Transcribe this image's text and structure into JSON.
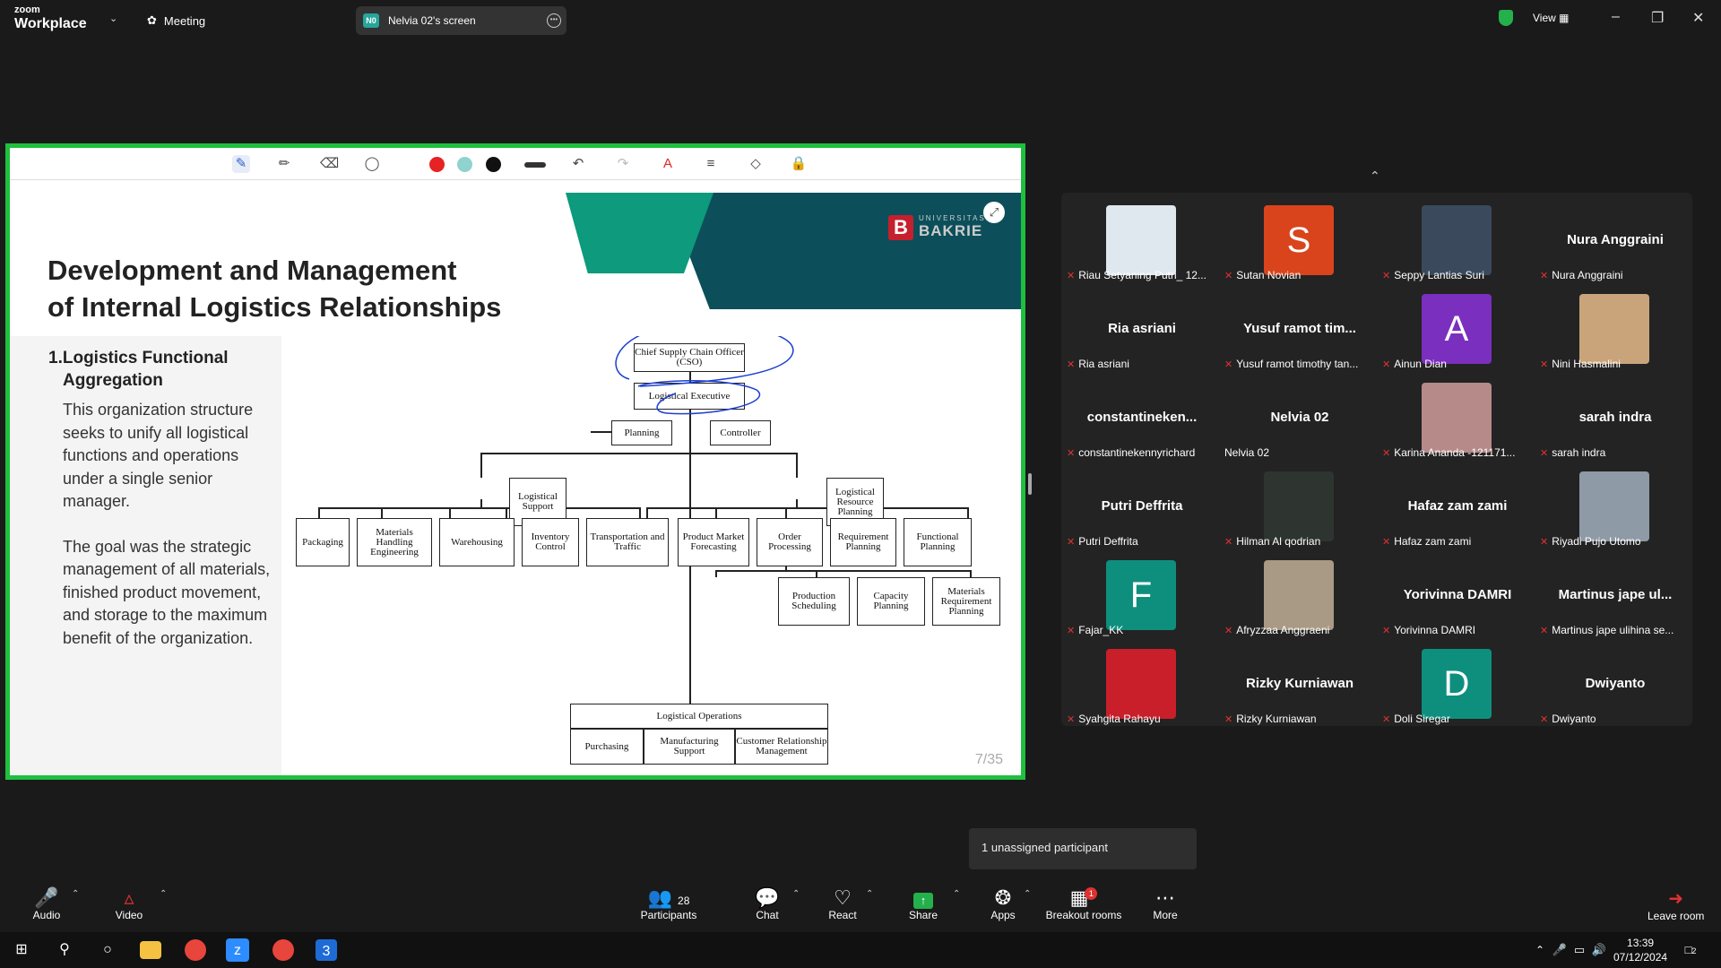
{
  "app": {
    "logo_top": "zoom",
    "logo_bottom": "Workplace",
    "meeting_label": "Meeting",
    "screen_badge": "N0",
    "screen_label": "Nelvia 02's screen",
    "view_label": "View"
  },
  "slide": {
    "title_line1": "Development and Management",
    "title_line2": "of Internal Logistics Relationships",
    "section_number": "1.",
    "section_title_line1": "Logistics Functional",
    "section_title_line2": "Aggregation",
    "paragraph1": "This organization structure seeks to unify all logistical functions and operations under a single senior manager.",
    "paragraph2": "The goal was the strategic management of all materials, finished product movement, and storage to the maximum benefit of the organization.",
    "brand_small": "UNIVERSITAS",
    "brand_big": "BAKRIE",
    "page": "7/35",
    "org": {
      "cso": "Chief Supply Chain Officer (CSO)",
      "exec": "Logistical Executive",
      "planning": "Planning",
      "controller": "Controller",
      "support": "Logistical Support",
      "resource": "Logistical Resource Planning",
      "packaging": "Packaging",
      "materials_handling": "Materials Handling Engineering",
      "warehousing": "Warehousing",
      "inventory": "Inventory Control",
      "transport": "Transportation and Traffic",
      "forecasting": "Product Market Forecasting",
      "order": "Order Processing",
      "requirement": "Requirement Planning",
      "functional": "Functional Planning",
      "production": "Production Scheduling",
      "capacity": "Capacity Planning",
      "mrp": "Materials Requirement Planning",
      "operations": "Logistical Operations",
      "purchasing": "Purchasing",
      "manufacturing": "Manufacturing Support",
      "crm": "Customer Relationship Management"
    }
  },
  "participants": [
    {
      "label": "Riau Setyaning Putri_ 12...",
      "avatar": "photo",
      "color": "#dfe7ef",
      "muted": true
    },
    {
      "label": "Sutan Novian",
      "avatar": "S",
      "color": "#d9441c",
      "muted": true
    },
    {
      "label": "Seppy Lantias Suri",
      "avatar": "photo",
      "color": "#3a4a5c",
      "muted": true
    },
    {
      "label": "Nura Anggraini",
      "big": "Nura Anggraini",
      "muted": true
    },
    {
      "label": "Ria asriani",
      "big": "Ria asriani",
      "muted": true
    },
    {
      "label": "Yusuf ramot timothy tan...",
      "big": "Yusuf ramot tim...",
      "muted": true
    },
    {
      "label": "Ainun Dian",
      "avatar": "A",
      "color": "#7b2fbe",
      "muted": true
    },
    {
      "label": "Nini Hasmalini",
      "avatar": "photo",
      "color": "#c9a47a",
      "muted": true
    },
    {
      "label": "constantinekennyrichard",
      "big": "constantineken...",
      "muted": true
    },
    {
      "label": "Nelvia 02",
      "big": "Nelvia 02",
      "muted": false
    },
    {
      "label": "Karina Ananda -121171...",
      "avatar": "photo",
      "color": "#b78a8a",
      "muted": true
    },
    {
      "label": "sarah indra",
      "big": "sarah indra",
      "muted": true
    },
    {
      "label": "Putri Deffrita",
      "big": "Putri Deffrita",
      "muted": true
    },
    {
      "label": "Hilman Al qodrian",
      "avatar": "photo",
      "color": "#2e3430",
      "muted": true
    },
    {
      "label": "Hafaz zam zami",
      "big": "Hafaz zam zami",
      "muted": true
    },
    {
      "label": "Riyadi Pujo Utomo",
      "avatar": "photo",
      "color": "#8e9aa6",
      "muted": true
    },
    {
      "label": "Fajar_KK",
      "avatar": "F",
      "color": "#0e8f7e",
      "muted": true
    },
    {
      "label": "Afryzzaa Anggraeni",
      "avatar": "photo",
      "color": "#a89a84",
      "muted": true
    },
    {
      "label": "Yorivinna DAMRI",
      "big": "Yorivinna DAMRI",
      "muted": true
    },
    {
      "label": "Martinus jape ulihina se...",
      "big": "Martinus jape ul...",
      "muted": true
    },
    {
      "label": "Syahgita Rahayu",
      "avatar": "photo",
      "color": "#c81f2b",
      "muted": true
    },
    {
      "label": "Rizky Kurniawan",
      "big": "Rizky Kurniawan",
      "muted": true
    },
    {
      "label": "Doli Siregar",
      "avatar": "D",
      "color": "#0e8f7e",
      "muted": true
    },
    {
      "label": "Dwiyanto",
      "big": "Dwiyanto",
      "muted": true
    }
  ],
  "tooltip": "1 unassigned participant",
  "toolbar": {
    "audio": "Audio",
    "video": "Video",
    "participants": "Participants",
    "participants_count": "28",
    "chat": "Chat",
    "react": "React",
    "share": "Share",
    "apps": "Apps",
    "breakout": "Breakout rooms",
    "breakout_badge": "1",
    "more": "More",
    "leave": "Leave room"
  },
  "taskbar": {
    "time": "13:39",
    "date": "07/12/2024",
    "notif": "2"
  },
  "colors": {
    "share_border": "#1fbf3f",
    "pen_red": "#e62222",
    "pen_cyan": "#8fd3cf",
    "pen_black": "#111111"
  }
}
